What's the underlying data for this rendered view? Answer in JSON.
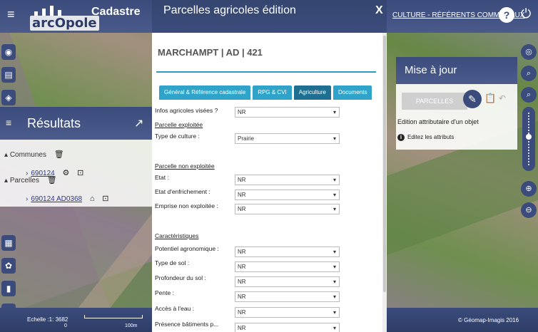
{
  "header": {
    "app_title": "Cadastre",
    "logo_text": "arcOpole",
    "culture_label": "CULTURE - RÉFÉRENTS COMMUNAUX",
    "help_label": "?"
  },
  "results": {
    "title": "Résultats",
    "communes_label": "Communes",
    "commune_id": "690124",
    "parcelles_label": "Parcelles",
    "parcelle_id": "690124 AD0368"
  },
  "scale": {
    "label": "Echelle :1: 3682",
    "zero": "0",
    "hundred": "100m"
  },
  "copyright": "© Géomap-Imagis 2016",
  "mise_a_jour": {
    "title": "Mise à jour",
    "parcelles_button": "PARCELLES",
    "edition_label": "Edition attributaire d'un objet",
    "edit_hint": "Editez les attributs"
  },
  "dialog": {
    "title": "Parcelles agricoles édition",
    "close": "X",
    "parcel_id": "MARCHAMPT | AD | 421",
    "tabs": [
      {
        "label": "Général & Référence cadastrale"
      },
      {
        "label": "RPG & CVI"
      },
      {
        "label": "Agriculture"
      },
      {
        "label": "Documents"
      }
    ],
    "active_tab": "Agriculture",
    "fields": {
      "infos_label": "Infos agricoles visées ?",
      "infos_value": "NR",
      "parcelle_exploitee": "Parcelle exploitée",
      "type_culture_label": "Type de culture :",
      "type_culture_value": "Prairie",
      "parcelle_non_exploitee": "Parcelle non exploitée",
      "etat_label": "Etat :",
      "etat_value": "NR",
      "enfrichement_label": "Etat d'enfrichement :",
      "enfrichement_value": "NR",
      "emprise_label": "Emprise non exploitée :",
      "emprise_value": "NR",
      "caracteristiques": "Caractéristiques",
      "potentiel_label": "Potentiel agronomique :",
      "potentiel_value": "NR",
      "type_sol_label": "Type de sol :",
      "type_sol_value": "NR",
      "profondeur_label": "Profondeur du sol :",
      "profondeur_value": "NR",
      "pente_label": "Pente :",
      "pente_value": "NR",
      "acces_eau_label": "Accès à l'eau :",
      "acces_eau_value": "NR",
      "presence_label": "Présence bâtiments p...",
      "presence_value": "NR"
    }
  },
  "colors": {
    "header": "#3b4c7c",
    "tab": "#2fa3c9",
    "tab_active": "#1f6f92",
    "rule": "#2e9bc0"
  }
}
